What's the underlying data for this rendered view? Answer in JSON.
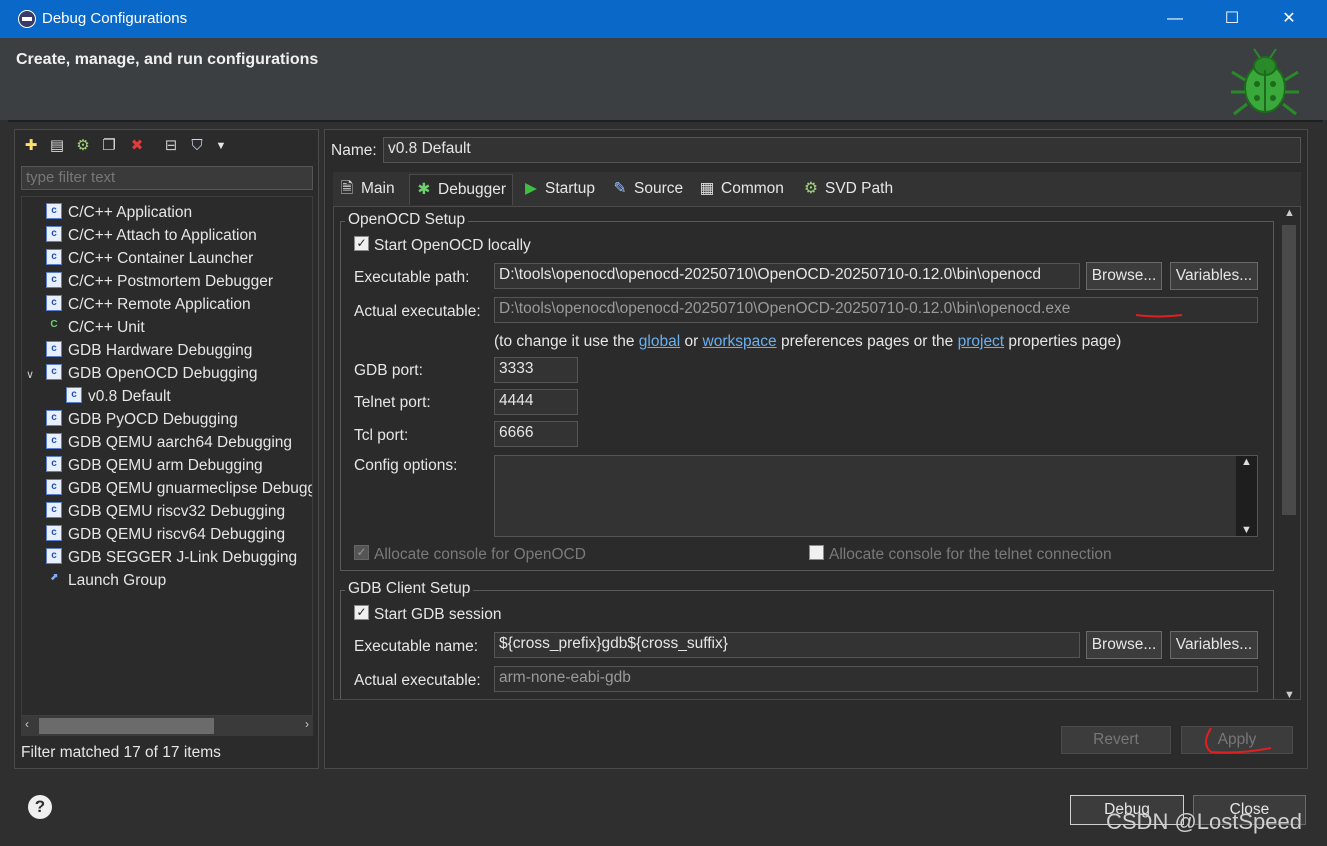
{
  "window": {
    "title": "Debug Configurations",
    "minimize": "—",
    "maximize": "☐",
    "close": "✕"
  },
  "header": {
    "title": "Create, manage, and run configurations"
  },
  "left": {
    "filter_placeholder": "type filter text",
    "tree": [
      {
        "label": "C/C++ Application",
        "icon": "c-config-icon"
      },
      {
        "label": "C/C++ Attach to Application",
        "icon": "c-config-icon"
      },
      {
        "label": "C/C++ Container Launcher",
        "icon": "c-config-icon"
      },
      {
        "label": "C/C++ Postmortem Debugger",
        "icon": "c-config-icon"
      },
      {
        "label": "C/C++ Remote Application",
        "icon": "c-config-icon"
      },
      {
        "label": "C/C++ Unit",
        "icon": "c-unit-icon"
      },
      {
        "label": "GDB Hardware Debugging",
        "icon": "c-config-icon"
      },
      {
        "label": "GDB OpenOCD Debugging",
        "icon": "c-config-icon"
      },
      {
        "label": "v0.8 Default",
        "icon": "c-config-icon"
      },
      {
        "label": "GDB PyOCD Debugging",
        "icon": "c-config-icon"
      },
      {
        "label": "GDB QEMU aarch64 Debugging",
        "icon": "c-config-icon"
      },
      {
        "label": "GDB QEMU arm Debugging",
        "icon": "c-config-icon"
      },
      {
        "label": "GDB QEMU gnuarmeclipse Debugging",
        "icon": "c-config-icon"
      },
      {
        "label": "GDB QEMU riscv32 Debugging",
        "icon": "c-config-icon"
      },
      {
        "label": "GDB QEMU riscv64 Debugging",
        "icon": "c-config-icon"
      },
      {
        "label": "GDB SEGGER J-Link Debugging",
        "icon": "c-config-icon"
      },
      {
        "label": "Launch Group",
        "icon": "launch-group-icon"
      }
    ],
    "status": "Filter matched 17 of 17 items"
  },
  "right": {
    "name_label": "Name:",
    "name_value": "v0.8 Default",
    "tabs": [
      "Main",
      "Debugger",
      "Startup",
      "Source",
      "Common",
      "SVD Path"
    ],
    "openocd": {
      "group_title": "OpenOCD Setup",
      "start_locally": "Start OpenOCD locally",
      "exec_label": "Executable path:",
      "exec_value": "D:\\tools\\openocd\\openocd-20250710\\OpenOCD-20250710-0.12.0\\bin\\openocd",
      "actual_label": "Actual executable:",
      "actual_value": "D:\\tools\\openocd\\openocd-20250710\\OpenOCD-20250710-0.12.0\\bin\\openocd.exe",
      "hint_prefix": "(to change it use the ",
      "hint_global": "global",
      "hint_or": " or ",
      "hint_workspace": "workspace",
      "hint_mid": " preferences pages or the ",
      "hint_project": "project",
      "hint_suffix": " properties page)",
      "gdb_port_label": "GDB port:",
      "gdb_port": "3333",
      "telnet_port_label": "Telnet port:",
      "telnet_port": "4444",
      "tcl_port_label": "Tcl port:",
      "tcl_port": "6666",
      "config_label": "Config options:",
      "config_value": "",
      "alloc_openocd": "Allocate console for OpenOCD",
      "alloc_telnet": "Allocate console for the telnet connection"
    },
    "gdb": {
      "group_title": "GDB Client Setup",
      "start_session": "Start GDB session",
      "exec_label": "Executable name:",
      "exec_value": "${cross_prefix}gdb${cross_suffix}",
      "actual_label": "Actual executable:",
      "actual_value": "arm-none-eabi-gdb"
    },
    "browse": "Browse...",
    "variables": "Variables...",
    "revert": "Revert",
    "apply": "Apply"
  },
  "footer": {
    "debug": "Debug",
    "close": "Close",
    "help": "?"
  },
  "watermark": "CSDN @LostSpeed"
}
